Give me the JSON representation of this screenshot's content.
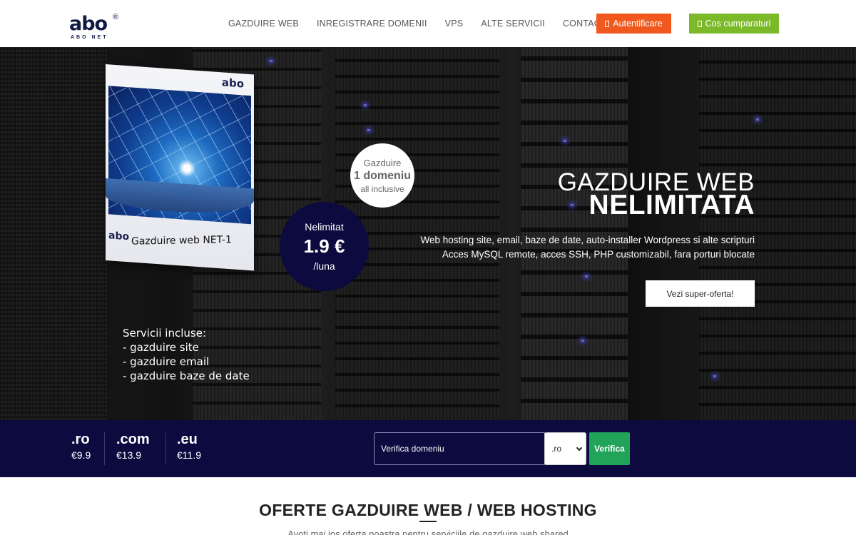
{
  "header": {
    "logo": {
      "text": "abo",
      "reg": "®",
      "sub": "ABO NET"
    },
    "nav": [
      "GAZDUIRE WEB",
      "INREGISTRARE DOMENII",
      "VPS",
      "ALTE SERVICII",
      "CONTACT"
    ],
    "auth_label": "Autentificare",
    "cart_label": "Cos cumparaturi",
    "auth_color": "#f1581e",
    "cart_color": "#7cb928"
  },
  "hero": {
    "box_logo": "abo",
    "box_title": "Gazduire web NET-1",
    "badge_white": {
      "line1": "Gazduire",
      "line2": "1 domeniu",
      "line3": "all inclusive"
    },
    "badge_dark": {
      "line1": "Nelimitat",
      "line2": "1.9 €",
      "line3": "/luna"
    },
    "services": [
      "Servicii incluse:",
      "- gazduire site",
      "- gazduire email",
      "- gazduire baze de date"
    ],
    "headline1": "GAZDUIRE WEB",
    "headline2": "NELIMITATA",
    "desc1": "Web hosting site, email, baze de date, auto-installer Wordpress si alte scripturi",
    "desc2": "Acces MySQL remote, acces SSH, PHP customizabil, fara porturi blocate",
    "offer_button": "Vezi super-oferta!"
  },
  "domain_bar": {
    "tlds": [
      {
        "name": ".ro",
        "price": "€9.9"
      },
      {
        "name": ".com",
        "price": "€13.9"
      },
      {
        "name": ".eu",
        "price": "€11.9"
      }
    ],
    "input_placeholder": "Verifica domeniu",
    "select_value": ".ro",
    "check_button": "Verifica",
    "bar_color": "#0c0a3e",
    "check_color": "#22a35a"
  },
  "section": {
    "title": "OFERTE GAZDUIRE WEB / WEB HOSTING",
    "subtitle": "Avoti mai jos oferta noastra pentru serviciile de gazduire web shared"
  }
}
